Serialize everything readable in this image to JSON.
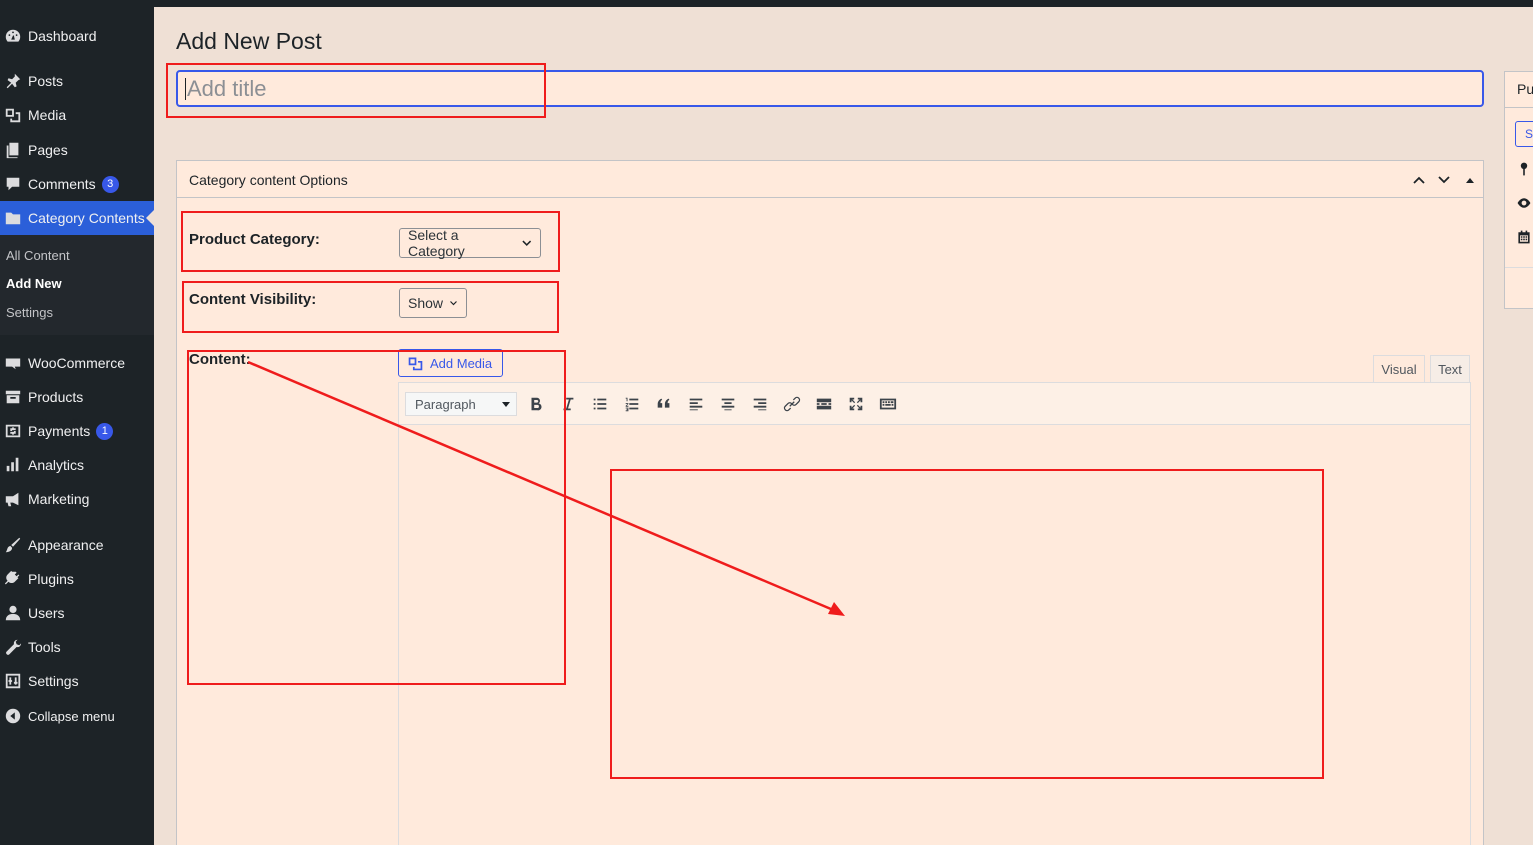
{
  "sidebar": {
    "items": [
      {
        "label": "Dashboard",
        "icon": "dashboard-icon"
      },
      {
        "label": "Posts",
        "icon": "pin-icon"
      },
      {
        "label": "Media",
        "icon": "media-icon"
      },
      {
        "label": "Pages",
        "icon": "pages-icon"
      },
      {
        "label": "Comments",
        "icon": "comment-icon",
        "badge": "3"
      },
      {
        "label": "Category Contents",
        "icon": "folder-icon",
        "current": true
      },
      {
        "label": "WooCommerce",
        "icon": "woo-icon"
      },
      {
        "label": "Products",
        "icon": "archive-icon"
      },
      {
        "label": "Payments",
        "icon": "dollar-icon",
        "badge": "1"
      },
      {
        "label": "Analytics",
        "icon": "bar-chart-icon"
      },
      {
        "label": "Marketing",
        "icon": "megaphone-icon"
      },
      {
        "label": "Appearance",
        "icon": "brush-icon"
      },
      {
        "label": "Plugins",
        "icon": "plug-icon"
      },
      {
        "label": "Users",
        "icon": "user-icon"
      },
      {
        "label": "Tools",
        "icon": "wrench-icon"
      },
      {
        "label": "Settings",
        "icon": "settings-icon"
      },
      {
        "label": "Collapse menu",
        "icon": "collapse-icon"
      }
    ],
    "submenu": [
      "All Content",
      "Add New",
      "Settings"
    ]
  },
  "main": {
    "page_title": "Add New Post",
    "title_placeholder": "Add title",
    "metabox": {
      "title": "Category content Options",
      "product_category_label": "Product Category:",
      "product_category_value": "Select a Category",
      "visibility_label": "Content Visibility:",
      "visibility_value": "Show",
      "content_label": "Content:"
    },
    "editor": {
      "add_media": "Add Media",
      "tab_visual": "Visual",
      "tab_text": "Text",
      "format_select": "Paragraph"
    }
  },
  "side_panel": {
    "title": "Pu",
    "button": "S"
  },
  "colors": {
    "sidebar_bg": "#1d2327",
    "accent": "#3858e9",
    "page_bg": "#efe0d5",
    "annotation": "#ef1c1c"
  }
}
